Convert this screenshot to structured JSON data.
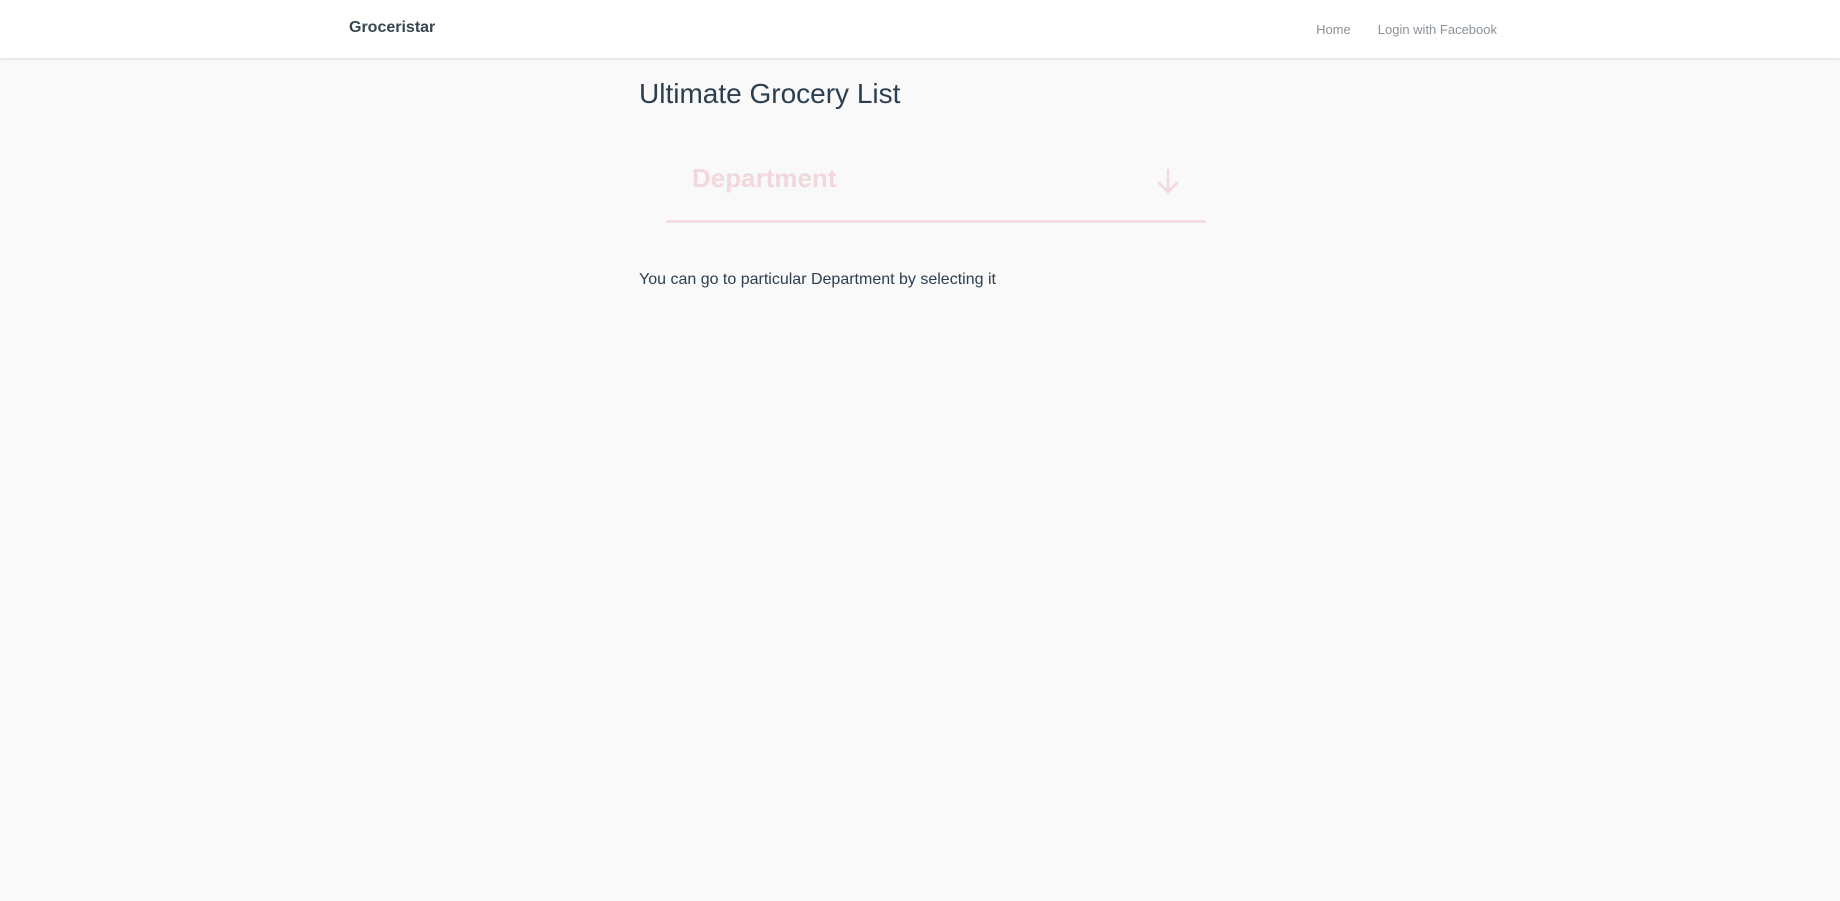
{
  "navbar": {
    "brand": "Groceristar",
    "links": [
      {
        "label": "Home"
      },
      {
        "label": "Login with Facebook"
      }
    ]
  },
  "main": {
    "title": "Ultimate Grocery List",
    "department_select": {
      "placeholder": "Department",
      "icon": "arrow-down-icon",
      "accent_color": "#f2d7dd"
    },
    "hint": "You can go to particular Department by selecting it"
  }
}
